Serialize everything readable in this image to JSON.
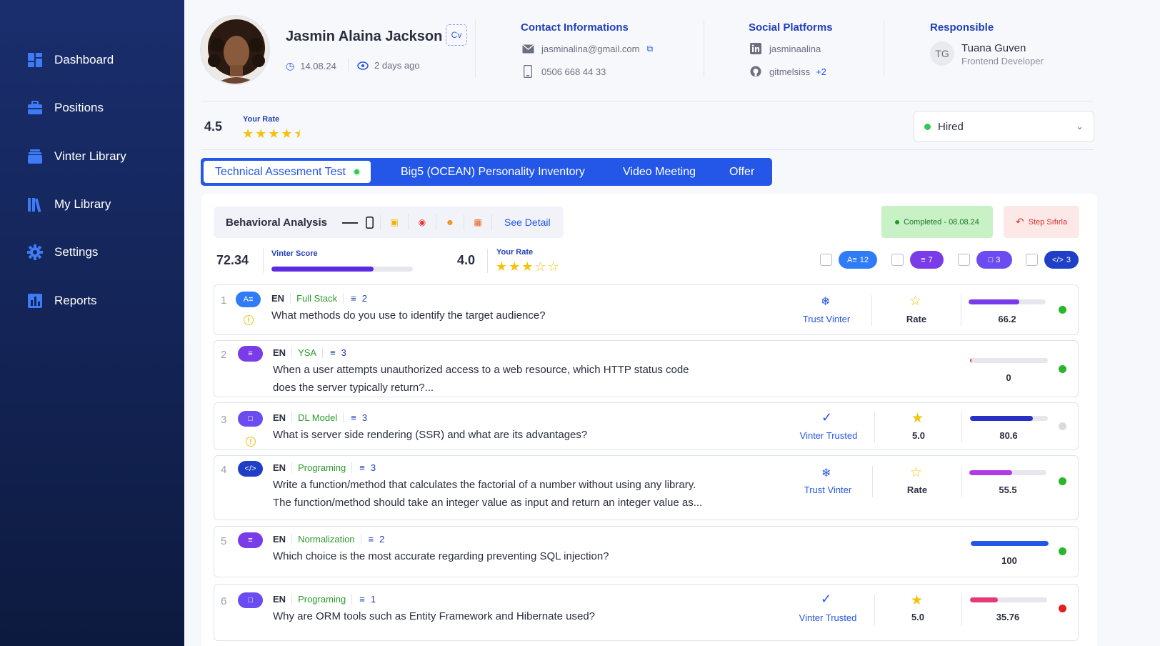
{
  "sidebar": {
    "items": [
      {
        "label": "Dashboard",
        "icon": "dashboard-icon"
      },
      {
        "label": "Positions",
        "icon": "briefcase-icon"
      },
      {
        "label": "Vinter Library",
        "icon": "library-icon"
      },
      {
        "label": "My Library",
        "icon": "books-icon"
      },
      {
        "label": "Settings",
        "icon": "gear-icon"
      },
      {
        "label": "Reports",
        "icon": "chart-icon"
      }
    ]
  },
  "candidate": {
    "name": "Jasmin Alaina Jackson",
    "cv_label": "Cv",
    "date": "14.08.24",
    "seen": "2 days ago"
  },
  "contact": {
    "title": "Contact Informations",
    "email": "jasminalina@gmail.com",
    "phone": "0506 668 44 33"
  },
  "social": {
    "title": "Social Platforms",
    "linkedin": "jasminaalina",
    "github": "gitmelsiss",
    "more": "+2"
  },
  "responsible": {
    "title": "Responsible",
    "initials": "TG",
    "name": "Tuana Guven",
    "role": "Frontend Developer"
  },
  "overall": {
    "rate": "4.5",
    "rate_label": "Your Rate",
    "stars": 4.5
  },
  "status": {
    "value": "Hired",
    "color": "#34c759"
  },
  "tabs": [
    {
      "label": "Technical Assesment Test",
      "active": true
    },
    {
      "label": "Big5 (OCEAN) Personality Inventory"
    },
    {
      "label": "Video Meeting"
    },
    {
      "label": "Offer"
    }
  ],
  "behavioral": {
    "title": "Behavioral Analysis",
    "see_detail": "See Detail",
    "completed": "Completed - 08.08.24",
    "step_reset": "Step Sıfırla"
  },
  "assessment": {
    "vinter_score": "72.34",
    "vinter_score_label": "Vinter Score",
    "vinter_score_pct": 0.7234,
    "your_rate": "4.0",
    "your_rate_label": "Your Rate",
    "your_rate_stars": 3
  },
  "filters": [
    {
      "count": "12",
      "color": "#2f7cf6",
      "icon": "text-icon"
    },
    {
      "count": "7",
      "color": "#7a3be8",
      "icon": "list-icon"
    },
    {
      "count": "3",
      "color": "#6a4cf0",
      "icon": "video-icon"
    },
    {
      "count": "3",
      "color": "#1f3fc7",
      "icon": "code-icon"
    }
  ],
  "questions": [
    {
      "num": "1",
      "lang": "EN",
      "category": "Full Stack",
      "count": "2",
      "text": "What methods do you use to identify the target audience?",
      "trust": "Trust Vinter",
      "rate": "Rate",
      "score": "66.2",
      "score_pct": 0.662,
      "bar_color": "#7a3be8",
      "status_color": "#2ab52a"
    },
    {
      "num": "2",
      "lang": "EN",
      "category": "YSA",
      "count": "3",
      "text": "When a user attempts unauthorized access to a web resource, which HTTP status code",
      "text2": "does the server typically return?...",
      "score": "0",
      "score_pct": 0.02,
      "bar_color": "#e53935",
      "status_color": "#2ab52a"
    },
    {
      "num": "3",
      "lang": "EN",
      "category": "DL Model",
      "count": "3",
      "text": "What is server side rendering (SSR) and what are its advantages?",
      "trust": "Vinter Trusted",
      "rate": "5.0",
      "score": "80.6",
      "score_pct": 0.806,
      "bar_color": "#2a2fc7",
      "status_color": "#d9dbe0"
    },
    {
      "num": "4",
      "lang": "EN",
      "category": "Programing",
      "count": "3",
      "text": "Write a function/method that calculates the factorial of a number without using any library.",
      "text2": "The function/method should take an integer value as input and return an integer value as...",
      "trust": "Trust Vinter",
      "rate": "Rate",
      "score": "55.5",
      "score_pct": 0.555,
      "bar_color": "#b23be8",
      "status_color": "#2ab52a"
    },
    {
      "num": "5",
      "lang": "EN",
      "category": "Normalization",
      "count": "2",
      "text": "Which choice is the most accurate regarding preventing SQL injection?",
      "score": "100",
      "score_pct": 1.0,
      "bar_color": "#2456e8",
      "status_color": "#2ab52a"
    },
    {
      "num": "6",
      "lang": "EN",
      "category": "Programing",
      "count": "1",
      "text": "Why are ORM tools such as Entity Framework and Hibernate used?",
      "trust": "Vinter Trusted",
      "rate": "5.0",
      "score": "35.76",
      "score_pct": 0.3576,
      "bar_color": "#e53978",
      "status_color": "#e02020"
    }
  ]
}
